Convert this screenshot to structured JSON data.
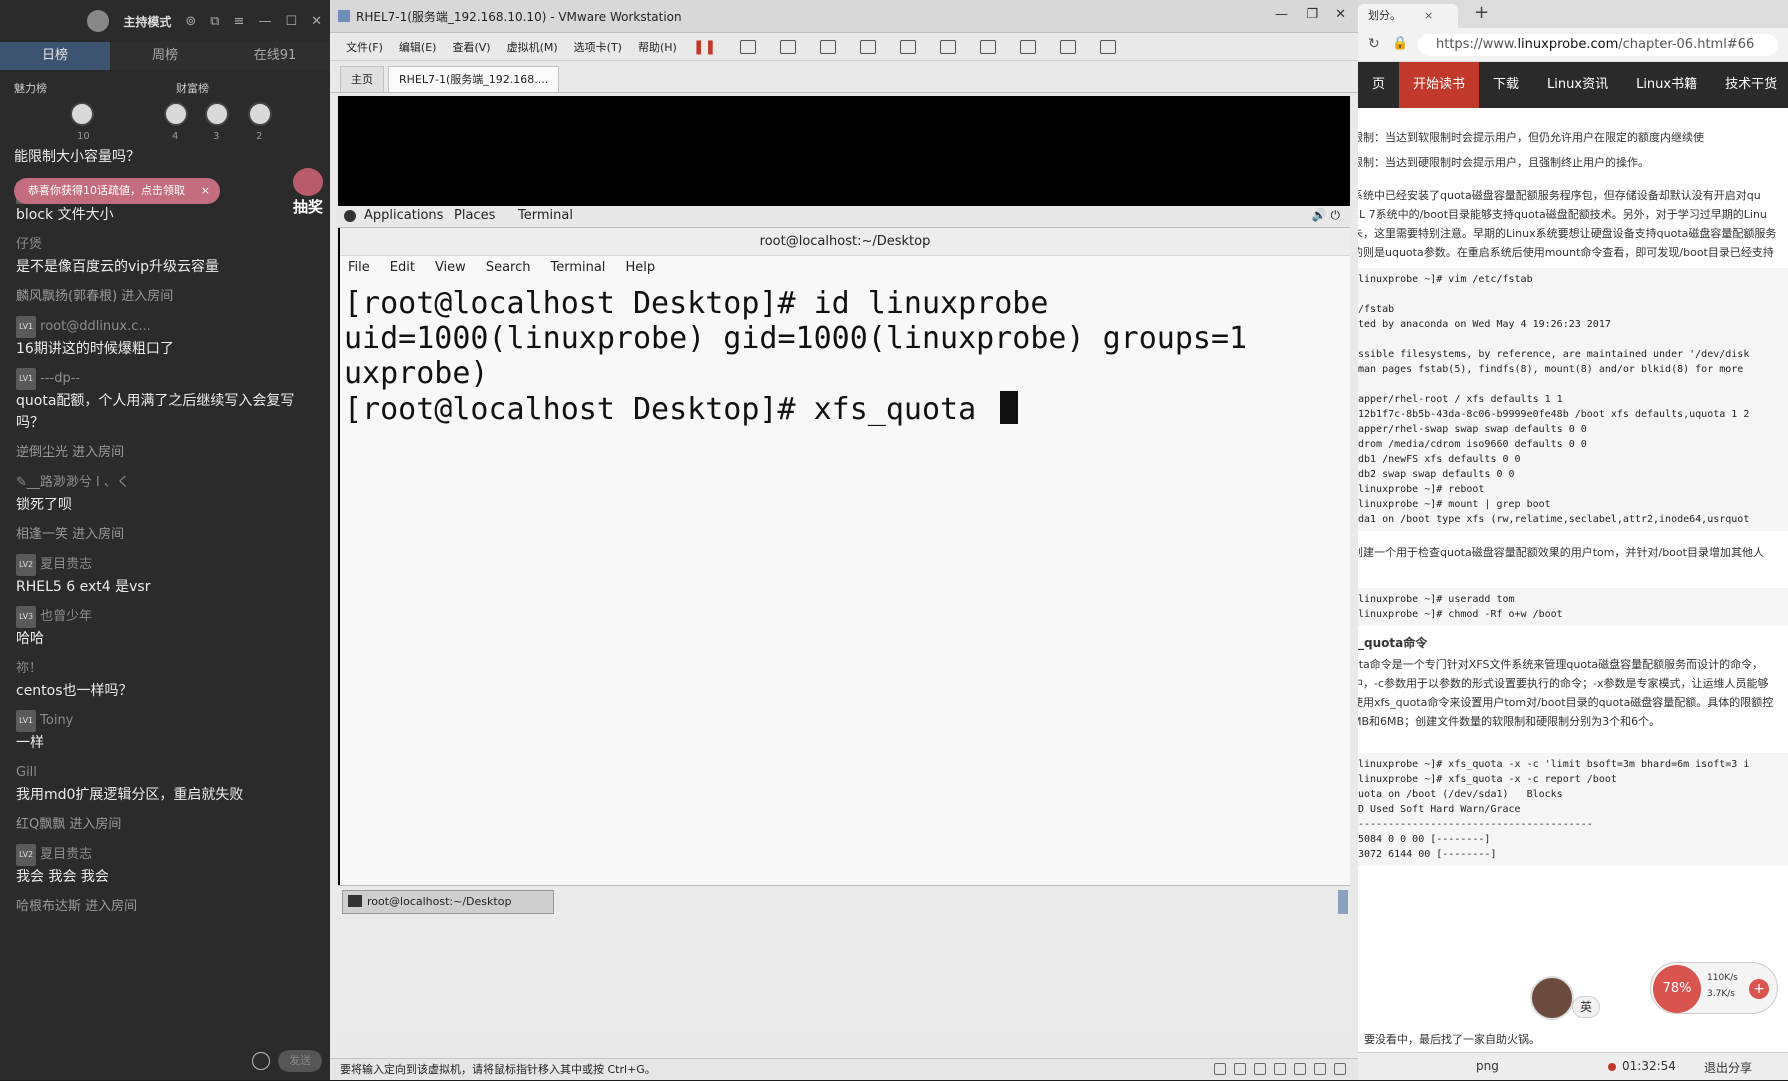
{
  "chat": {
    "mode_label": "主持模式",
    "tabs": [
      "日榜",
      "周榜",
      "在线91"
    ],
    "charm_label": "魅力榜",
    "wealth_label": "财富榜",
    "charm_rank_num": "10",
    "wealth_rank_nums": [
      "4",
      "3",
      "2"
    ],
    "top_cut_text": "能限制大小容量吗？",
    "banner_text": "恭喜你获得10话疏値，点击领取",
    "lottery_label": "抽奖",
    "messages": [
      {
        "name": "夏目贵志",
        "level": "LV2",
        "text": "block 文件大小"
      },
      {
        "name": "仔煲",
        "level": "",
        "text": "是不是像百度云的vip升级云容量"
      },
      {
        "name": "麟风飘扬(郭春根) 进入房间",
        "level": "",
        "text": ""
      },
      {
        "name": "root@ddlinux.c...",
        "level": "LV1",
        "text": "16期讲这的时候爆粗口了"
      },
      {
        "name": "---dp--",
        "level": "LV1",
        "text": "quota配额，个人用满了之后继续写入会复写吗？"
      },
      {
        "name": "逆倒尘光 进入房间",
        "level": "",
        "text": ""
      },
      {
        "name": "✎__路渺渺兮 l 、く",
        "level": "",
        "text": "锁死了呗"
      },
      {
        "name": "相逢一笑 进入房间",
        "level": "",
        "text": ""
      },
      {
        "name": "夏目贵志",
        "level": "LV2",
        "text": "RHEL5 6 ext4 是vsr"
      },
      {
        "name": "也曾少年",
        "level": "LV3",
        "text": "哈哈"
      },
      {
        "name": "祢！",
        "level": "",
        "text": "centos也一样吗？"
      },
      {
        "name": "Toiny",
        "level": "LV1",
        "text": "一样"
      },
      {
        "name": "Gill",
        "level": "",
        "text": "我用md0扩展逻辑分区，重启就失败"
      },
      {
        "name": "红Q飘飘 进入房间",
        "level": "",
        "text": ""
      },
      {
        "name": "夏目贵志",
        "level": "LV2",
        "text": "我会 我会 我会"
      },
      {
        "name": "哈根布达斯 进入房间",
        "level": "",
        "text": ""
      }
    ],
    "send_label": "发送"
  },
  "vmware": {
    "title": "RHEL7-1(服务端_192.168.10.10) - VMware Workstation",
    "menu": [
      "文件(F)",
      "编辑(E)",
      "查看(V)",
      "虚拟机(M)",
      "选项卡(T)",
      "帮助(H)"
    ],
    "tabs": [
      "主页",
      "RHEL7-1(服务端_192.168...."
    ],
    "status_text": "要将输入定向到该虚拟机，请将鼠标指针移入其中或按 Ctrl+G。"
  },
  "gnome": {
    "applications": "Applications",
    "places": "Places",
    "terminal": "Terminal",
    "taskbar_item": "root@localhost:~/Desktop"
  },
  "terminal": {
    "title": "root@localhost:~/Desktop",
    "menu": [
      "File",
      "Edit",
      "View",
      "Search",
      "Terminal",
      "Help"
    ],
    "lines": [
      "[root@localhost Desktop]# id linuxprobe",
      "uid=1000(linuxprobe) gid=1000(linuxprobe) groups=1",
      "uxprobe)",
      "[root@localhost Desktop]# xfs_quota "
    ]
  },
  "browser": {
    "tab_title": "划分。",
    "url_prefix": "https://www.",
    "url_domain": "linuxprobe.com",
    "url_suffix": "/chapter-06.html#66",
    "nav": [
      "页",
      "开始读书",
      "下载",
      "Linux资讯",
      "Linux书籍",
      "技术干货"
    ],
    "paragraphs": [
      "限制：当达到软限制时会提示用户，但仍允许用户在限定的额度内继续使",
      "限制：当达到硬限制时会提示用户，且强制终止用户的操作。",
      "系统中已经安装了quota磁盘容量配额服务程序包，但存储设备却默认没有开启对qu",
      "EL 7系统中的/boot目录能够支持quota磁盘配额技术。另外，对于学习过早期的Linu",
      "朱，这里需要特别注意。早期的Linux系统要想让硬盘设备支持quota磁盘容量配额服务",
      "的则是uquota参数。在重启系统后使用mount命令查看，即可发现/boot目录已经支持"
    ],
    "code1": "linuxprobe ~]# vim /etc/fstab\n\n/fstab\nted by anaconda on Wed May 4 19:26:23 2017\n\nssible filesystems, by reference, are maintained under '/dev/disk\nman pages fstab(5), findfs(8), mount(8) and/or blkid(8) for more\n\napper/rhel-root / xfs defaults 1 1\n12b1f7c-8b5b-43da-8c06-b9999e0fe48b /boot xfs defaults,uquota 1 2\napper/rhel-swap swap swap defaults 0 0\ndrom /media/cdrom iso9660 defaults 0 0\ndb1 /newFS xfs defaults 0 0\ndb2 swap swap defaults 0 0\nlinuxprobe ~]# reboot\nlinuxprobe ~]# mount | grep boot\nda1 on /boot type xfs (rw,relatime,seclabel,attr2,inode64,usrquot",
    "para_mid": "创建一个用于检查quota磁盘容量配额效果的用户tom，并针对/boot目录增加其他人",
    "code2": "linuxprobe ~]# useradd tom\nlinuxprobe ~]# chmod -Rf o+w /boot",
    "heading": "_quota命令",
    "paragraphs2": [
      "ota命令是一个专门针对XFS文件系统来管理quota磁盘容量配额服务而设计的命令，",
      "中，-c参数用于以参数的形式设置要执行的命令；-x参数是专家模式，让运维人员能够",
      "使用xfs_quota命令来设置用户tom对/boot目录的quota磁盘容量配额。具体的限额控",
      "MB和6MB；创建文件数量的软限制和硬限制分别为3个和6个。"
    ],
    "code3": "linuxprobe ~]# xfs_quota -x -c 'limit bsoft=3m bhard=6m isoft=3 i\nlinuxprobe ~]# xfs_quota -x -c report /boot\nuota on /boot (/dev/sda1)   Blocks\nD Used Soft Hard Warn/Grace\n---------------------------------------\n5084 0 0 00 [--------]\n3072 6144 00 [--------]",
    "bottom_hint": "要没看中，最后找了一家自助火锅。",
    "presenter_tag": "英",
    "net_percent": "78%",
    "net_up": "110K/s",
    "net_down": "3.7K/s",
    "status_fn": "png",
    "status_time": "01:32:54",
    "status_exit": "退出分享"
  }
}
